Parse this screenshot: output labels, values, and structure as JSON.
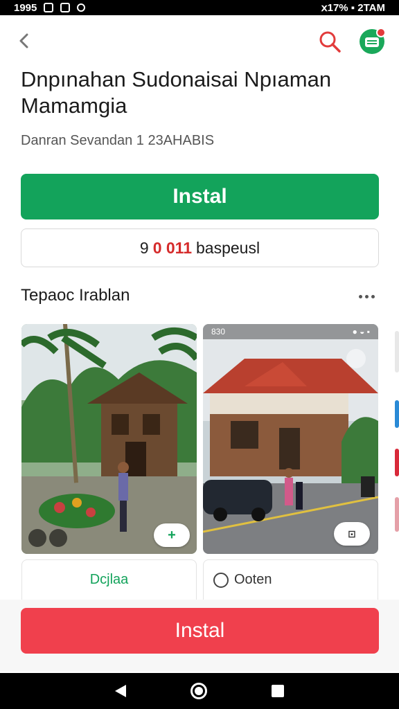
{
  "status_bar": {
    "time": "1995",
    "right_text": "𝗑17% ▪ 2TAM"
  },
  "header": {
    "back_icon": "chevron-left-icon",
    "search_icon": "search-icon",
    "app_icon": "app-icon"
  },
  "app": {
    "title": "Dnpınahan Sudonaisai Npıaman Mamamgia",
    "subtitle": "Danran Sevandan 1 23AHABIS"
  },
  "install_button": {
    "label": "Instal",
    "color": "#13a35b"
  },
  "secondary_button": {
    "count": "9",
    "count_red": "0 011",
    "label": "baspeusl"
  },
  "section": {
    "title": "Tepaoc Irablan",
    "more_icon": "more-horizontal-icon"
  },
  "cards": [
    {
      "fab_label": "+",
      "action_label": "Dcjlaa"
    },
    {
      "status_left": "830",
      "fab_label": "⊡",
      "action_label": "Ooten",
      "action_icon": "open-icon"
    }
  ],
  "bottom_install": {
    "label": "Instal",
    "color": "#f0404d"
  },
  "nav": {
    "back": "back-triangle-icon",
    "home": "home-circle-icon",
    "recent": "recent-square-icon"
  }
}
